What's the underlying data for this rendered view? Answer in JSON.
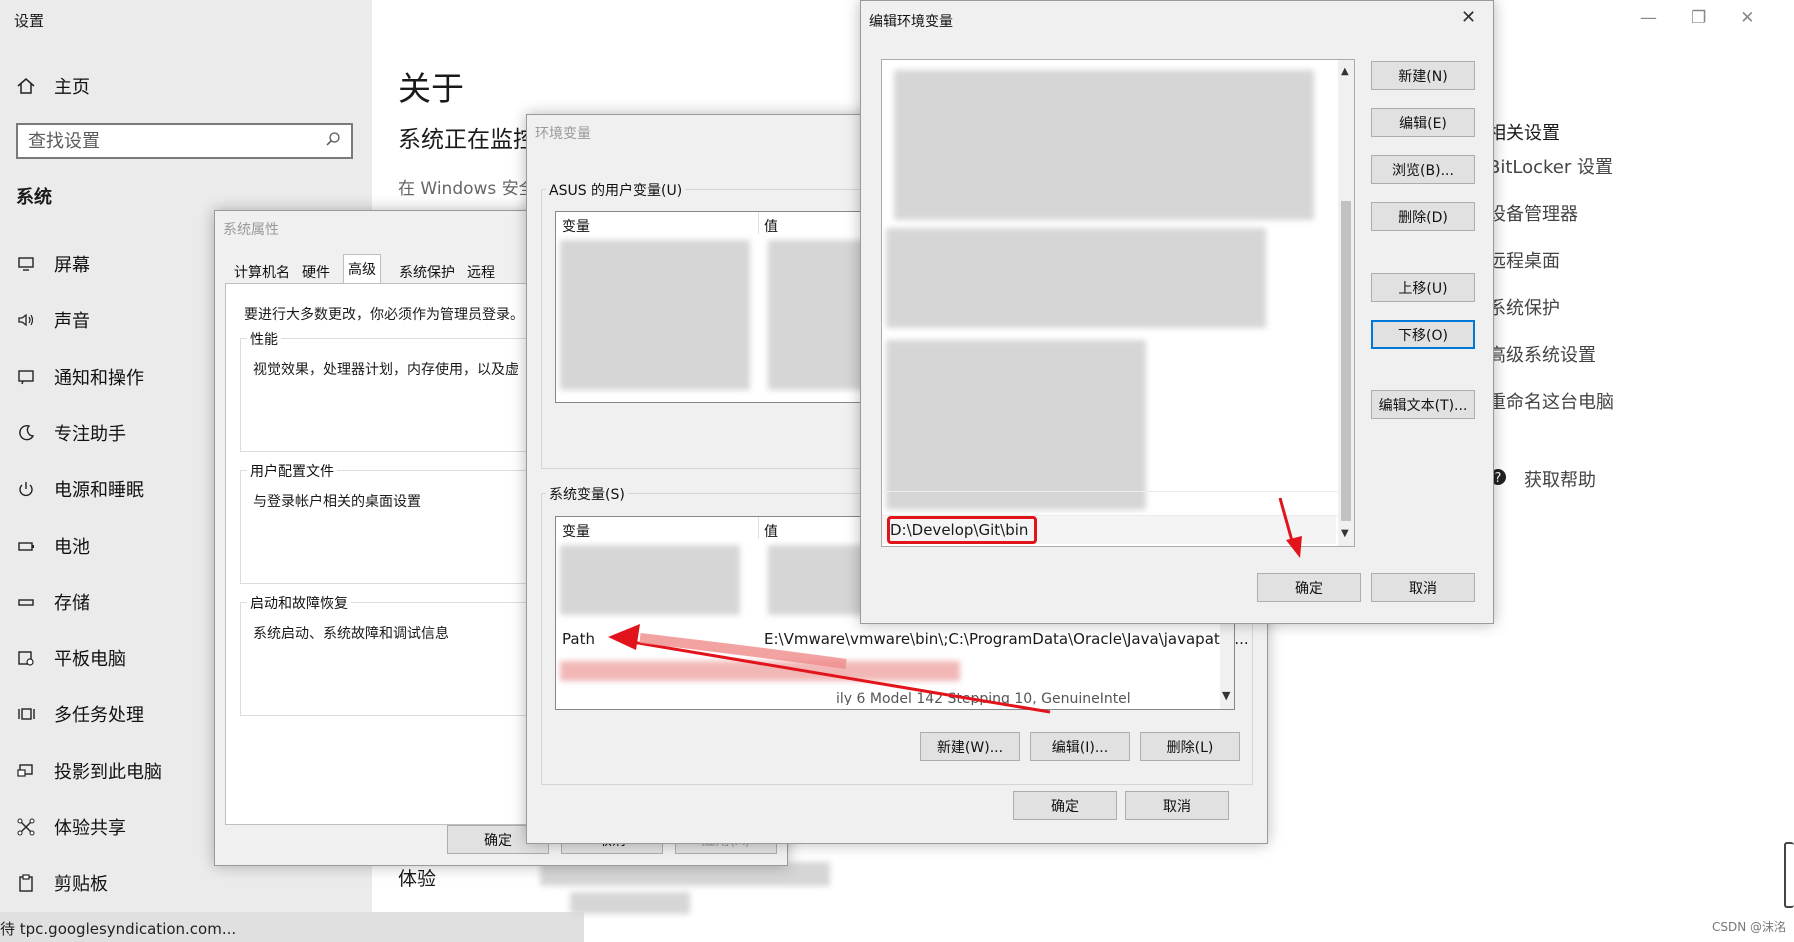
{
  "settings": {
    "title": "设置",
    "home": "主页",
    "search_placeholder": "查找设置",
    "section": "系统",
    "nav": [
      {
        "label": "屏幕",
        "icon": "monitor-icon"
      },
      {
        "label": "声音",
        "icon": "speaker-icon"
      },
      {
        "label": "通知和操作",
        "icon": "notification-icon"
      },
      {
        "label": "专注助手",
        "icon": "moon-icon"
      },
      {
        "label": "电源和睡眠",
        "icon": "power-icon"
      },
      {
        "label": "电池",
        "icon": "battery-icon"
      },
      {
        "label": "存储",
        "icon": "storage-icon"
      },
      {
        "label": "平板电脑",
        "icon": "tablet-icon"
      },
      {
        "label": "多任务处理",
        "icon": "multitask-icon"
      },
      {
        "label": "投影到此电脑",
        "icon": "project-icon"
      },
      {
        "label": "体验共享",
        "icon": "share-icon"
      },
      {
        "label": "剪贴板",
        "icon": "clipboard-icon"
      }
    ],
    "status_url": "待 tpc.googlesyndication.com...",
    "main": {
      "title": "关于",
      "monitoring": "系统正在监控",
      "windows_line": "在 Windows 安全",
      "experience": "体验"
    },
    "related": {
      "title": "相关设置",
      "links": [
        "BitLocker 设置",
        "设备管理器",
        "远程桌面",
        "系统保护",
        "高级系统设置",
        "重命名这台电脑"
      ],
      "help": "获取帮助"
    }
  },
  "sysprop": {
    "title": "系统属性",
    "tabs": [
      "计算机名",
      "硬件",
      "高级",
      "系统保护",
      "远程"
    ],
    "admin_note": "要进行大多数更改，你必须作为管理员登录。",
    "groups": [
      {
        "label": "性能",
        "desc": "视觉效果，处理器计划，内存使用，以及虚"
      },
      {
        "label": "用户配置文件",
        "desc": "与登录帐户相关的桌面设置"
      },
      {
        "label": "启动和故障恢复",
        "desc": "系统启动、系统故障和调试信息"
      }
    ],
    "buttons": {
      "ok": "确定",
      "cancel": "取消",
      "apply": "应用(A)"
    }
  },
  "envvar": {
    "title": "环境变量",
    "user_group": "ASUS 的用户变量(U)",
    "system_group": "系统变量(S)",
    "col_var": "变量",
    "col_val": "值",
    "path_name": "Path",
    "path_value": "E:\\Vmware\\vmware\\bin\\;C:\\ProgramData\\Oracle\\Java\\javapath;...",
    "partial_row": "ily 6 Model 142 Stepping 10, GenuineIntel",
    "buttons": {
      "new": "新建(W)...",
      "edit": "编辑(I)...",
      "delete": "删除(L)",
      "ok": "确定",
      "cancel": "取消"
    }
  },
  "edit": {
    "title": "编辑环境变量",
    "new_entry": "D:\\Develop\\Git\\bin",
    "buttons": {
      "new": "新建(N)",
      "edit": "编辑(E)",
      "browse": "浏览(B)...",
      "delete": "删除(D)",
      "up": "上移(U)",
      "down": "下移(O)",
      "edit_text": "编辑文本(T)...",
      "ok": "确定",
      "cancel": "取消"
    }
  },
  "watermark": "CSDN @沫洺",
  "colors": {
    "annotation": "#e2141b",
    "focus": "#0078d7",
    "sidebar": "#ebebeb",
    "dialog": "#f0f0f0"
  }
}
